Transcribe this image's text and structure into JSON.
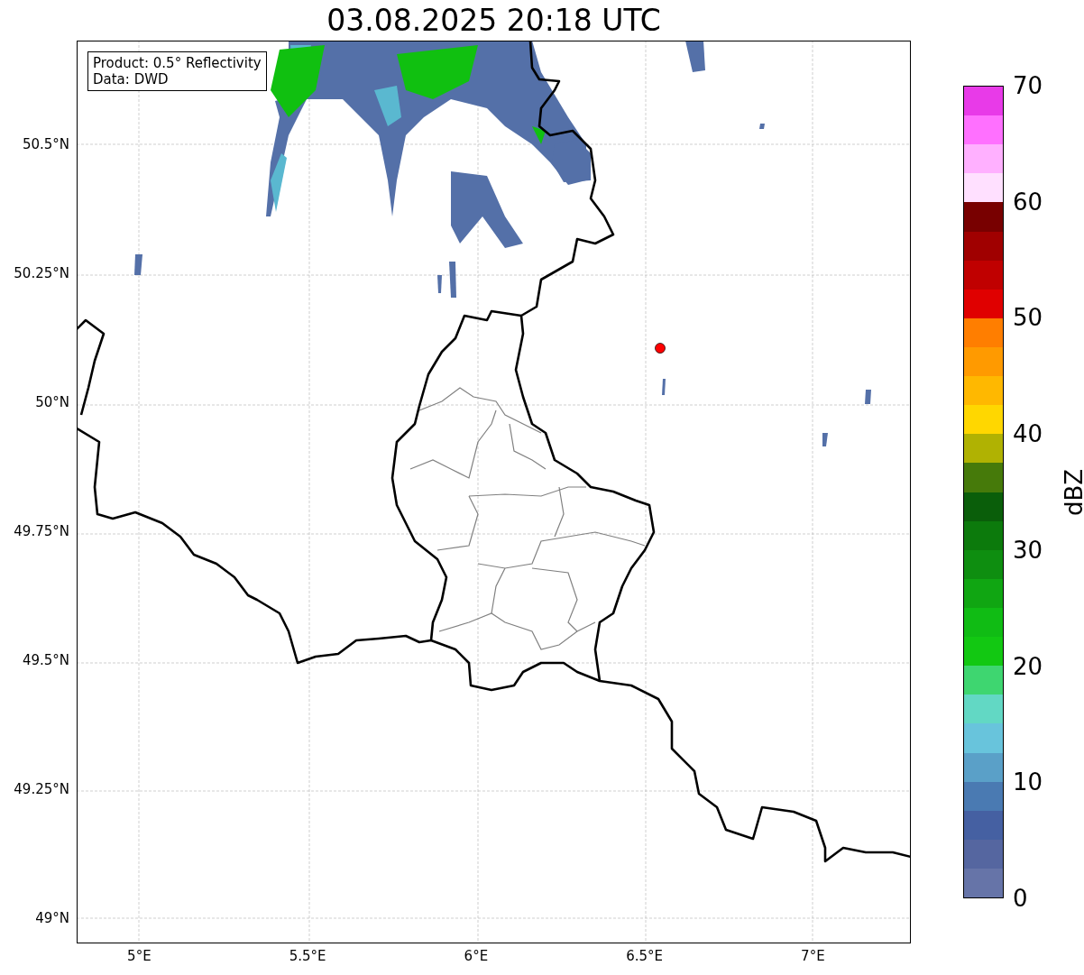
{
  "title": "03.08.2025 20:18 UTC",
  "legend": {
    "lines": [
      "Product: 0.5° Reflectivity",
      "Data: DWD"
    ]
  },
  "map": {
    "y_ticks": [
      "50.5°N",
      "50.25°N",
      "50°N",
      "49.75°N",
      "49.5°N",
      "49.25°N",
      "49°N"
    ],
    "x_ticks": [
      "5°E",
      "5.5°E",
      "6°E",
      "6.5°E",
      "7°E"
    ]
  },
  "colorbar": {
    "label": "dBZ",
    "ticks": [
      "70",
      "60",
      "50",
      "40",
      "30",
      "20",
      "10",
      "0"
    ],
    "bins": [
      {
        "color": "#e83ae8"
      },
      {
        "color": "#ff70ff"
      },
      {
        "color": "#ffb0ff"
      },
      {
        "color": "#ffe0ff"
      },
      {
        "color": "#780000"
      },
      {
        "color": "#a00000"
      },
      {
        "color": "#c00000"
      },
      {
        "color": "#e00000"
      },
      {
        "color": "#ff7e00"
      },
      {
        "color": "#ff9a00"
      },
      {
        "color": "#ffb800"
      },
      {
        "color": "#ffd700"
      },
      {
        "color": "#b0b202"
      },
      {
        "color": "#467a0a"
      },
      {
        "color": "#0a5e0a"
      },
      {
        "color": "#0c7a0c"
      },
      {
        "color": "#0e8e10"
      },
      {
        "color": "#10a612"
      },
      {
        "color": "#10bc14"
      },
      {
        "color": "#12c812"
      },
      {
        "color": "#3ed670"
      },
      {
        "color": "#62d8c4"
      },
      {
        "color": "#68c4dc"
      },
      {
        "color": "#5aa0c8"
      },
      {
        "color": "#4a7ab2"
      },
      {
        "color": "#4560a2"
      },
      {
        "color": "#5566a0"
      },
      {
        "color": "#6674a8"
      }
    ]
  }
}
